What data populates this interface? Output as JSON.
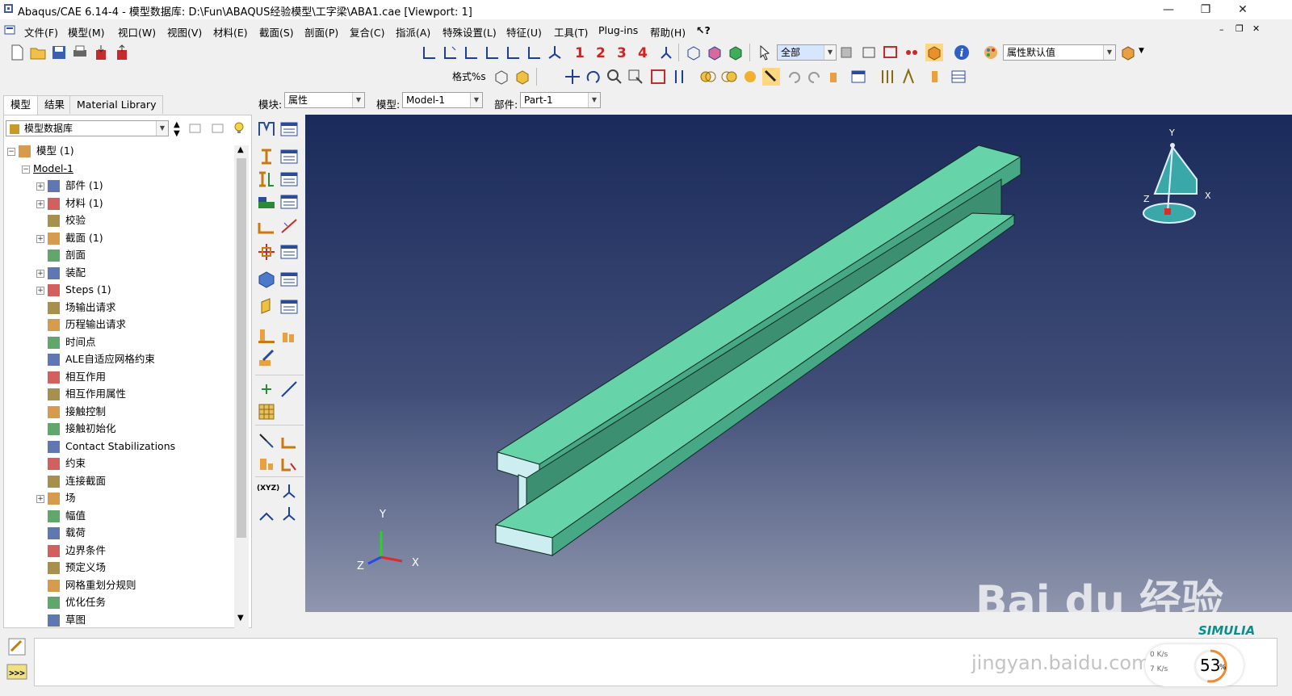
{
  "window": {
    "title": "Abaqus/CAE 6.14-4 - 模型数据库: D:\\Fun\\ABAQUS经验模型\\工字梁\\ABA1.cae [Viewport: 1]"
  },
  "menubar": {
    "items": [
      "文件(F)",
      "模型(M)",
      "视口(W)",
      "视图(V)",
      "材料(E)",
      "截面(S)",
      "剖面(P)",
      "复合(C)",
      "指派(A)",
      "特殊设置(L)",
      "特征(U)",
      "工具(T)",
      "Plug-ins",
      "帮助(H)"
    ]
  },
  "toolbar": {
    "view_numbers": [
      "1",
      "2",
      "3",
      "4"
    ],
    "selection_filter": "全部",
    "render_style_label": "格式%s",
    "attribute_combo": "属性默认值"
  },
  "left_panel": {
    "tabs": [
      "模型",
      "结果",
      "Material Library"
    ],
    "database_combo": "模型数据库",
    "tree": [
      {
        "label": "模型 (1)",
        "level": 0,
        "expander": "−"
      },
      {
        "label": "Model-1",
        "level": 1,
        "expander": "−"
      },
      {
        "label": "部件 (1)",
        "level": 2,
        "expander": "+"
      },
      {
        "label": "材料 (1)",
        "level": 2,
        "expander": "+"
      },
      {
        "label": "校验",
        "level": 2,
        "expander": ""
      },
      {
        "label": "截面 (1)",
        "level": 2,
        "expander": "+"
      },
      {
        "label": "剖面",
        "level": 2,
        "expander": ""
      },
      {
        "label": "装配",
        "level": 2,
        "expander": "+"
      },
      {
        "label": "Steps (1)",
        "level": 2,
        "expander": "+"
      },
      {
        "label": "场输出请求",
        "level": 2,
        "expander": ""
      },
      {
        "label": "历程输出请求",
        "level": 2,
        "expander": ""
      },
      {
        "label": "时间点",
        "level": 2,
        "expander": ""
      },
      {
        "label": "ALE自适应网格约束",
        "level": 2,
        "expander": ""
      },
      {
        "label": "相互作用",
        "level": 2,
        "expander": ""
      },
      {
        "label": "相互作用属性",
        "level": 2,
        "expander": ""
      },
      {
        "label": "接触控制",
        "level": 2,
        "expander": ""
      },
      {
        "label": "接触初始化",
        "level": 2,
        "expander": ""
      },
      {
        "label": "Contact Stabilizations",
        "level": 2,
        "expander": ""
      },
      {
        "label": "约束",
        "level": 2,
        "expander": ""
      },
      {
        "label": "连接截面",
        "level": 2,
        "expander": ""
      },
      {
        "label": "场",
        "level": 2,
        "expander": "+"
      },
      {
        "label": "幅值",
        "level": 2,
        "expander": ""
      },
      {
        "label": "载荷",
        "level": 2,
        "expander": ""
      },
      {
        "label": "边界条件",
        "level": 2,
        "expander": ""
      },
      {
        "label": "预定义场",
        "level": 2,
        "expander": ""
      },
      {
        "label": "网格重划分规则",
        "level": 2,
        "expander": ""
      },
      {
        "label": "优化任务",
        "level": 2,
        "expander": ""
      },
      {
        "label": "草图",
        "level": 2,
        "expander": ""
      }
    ]
  },
  "context_bar": {
    "module_label": "模块:",
    "module_value": "属性",
    "model_label": "模型:",
    "model_value": "Model-1",
    "part_label": "部件:",
    "part_value": "Part-1"
  },
  "viewport": {
    "triad_labels": {
      "x": "X",
      "y": "Y",
      "z": "Z"
    },
    "view_cube_labels": {
      "x": "X",
      "y": "Y",
      "z": "Z"
    },
    "beam_color": "#66d3a8",
    "brand": "SIMULIA"
  },
  "watermark": {
    "line1": "Bai du 经验",
    "line2": "jingyan.baidu.com"
  },
  "speed_widget": {
    "percent": "53",
    "unit": "%",
    "up": "0 K/s",
    "down": "7 K/s"
  }
}
